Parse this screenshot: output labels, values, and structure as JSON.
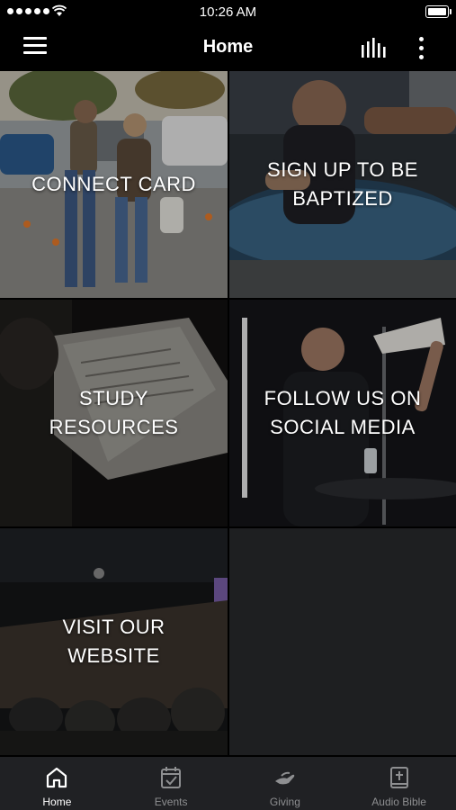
{
  "status_bar": {
    "time": "10:26 AM"
  },
  "header": {
    "title": "Home"
  },
  "tiles": [
    {
      "label_line1": "CONNECT CARD",
      "label_line2": ""
    },
    {
      "label_line1": "SIGN UP TO BE",
      "label_line2": "BAPTIZED"
    },
    {
      "label_line1": "STUDY",
      "label_line2": "RESOURCES"
    },
    {
      "label_line1": "FOLLOW US ON",
      "label_line2": "SOCIAL MEDIA"
    },
    {
      "label_line1": "VISIT OUR",
      "label_line2": "WEBSITE"
    }
  ],
  "tabs": [
    {
      "label": "Home",
      "icon": "home-icon",
      "active": true
    },
    {
      "label": "Events",
      "icon": "calendar-check-icon",
      "active": false
    },
    {
      "label": "Giving",
      "icon": "giving-hand-icon",
      "active": false
    },
    {
      "label": "Audio Bible",
      "icon": "bible-icon",
      "active": false
    }
  ],
  "colors": {
    "background": "#000000",
    "tab_bar": "#202124",
    "tab_inactive": "#8e8f91",
    "tab_active": "#ffffff"
  }
}
